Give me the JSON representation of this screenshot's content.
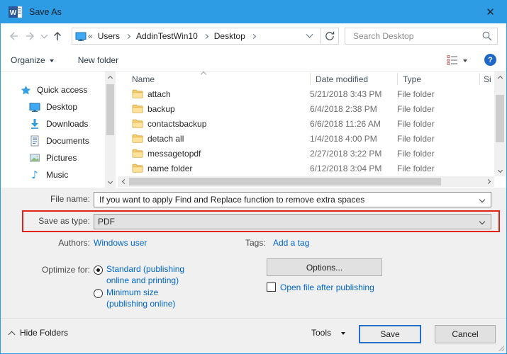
{
  "window": {
    "title": "Save As"
  },
  "icons": {
    "help_glyph": "?",
    "music_glyph": "♪",
    "word_glyph": "W"
  },
  "navbar": {
    "breadcrumb": {
      "collapsed_indicator": "«",
      "items": [
        "Users",
        "AddinTestWin10",
        "Desktop"
      ]
    },
    "search": {
      "placeholder": "Search Desktop"
    }
  },
  "toolbar": {
    "organize_label": "Organize",
    "new_folder_label": "New folder"
  },
  "sidebar": {
    "items": [
      {
        "label": "Quick access",
        "pinned": false
      },
      {
        "label": "Desktop",
        "pinned": true
      },
      {
        "label": "Downloads",
        "pinned": true
      },
      {
        "label": "Documents",
        "pinned": true
      },
      {
        "label": "Pictures",
        "pinned": true
      },
      {
        "label": "Music",
        "pinned": false
      }
    ]
  },
  "filelist": {
    "columns": [
      "Name",
      "Date modified",
      "Type",
      "Si"
    ],
    "rows": [
      {
        "name": "attach",
        "date": "5/21/2018 3:43 PM",
        "type": "File folder"
      },
      {
        "name": "backup",
        "date": "6/4/2018 2:38 PM",
        "type": "File folder"
      },
      {
        "name": "contactsbackup",
        "date": "6/6/2018 11:26 AM",
        "type": "File folder"
      },
      {
        "name": "detach all",
        "date": "1/4/2018 4:00 PM",
        "type": "File folder"
      },
      {
        "name": "messagetopdf",
        "date": "2/27/2018 3:22 PM",
        "type": "File folder"
      },
      {
        "name": "name folder",
        "date": "6/12/2018 3:04 PM",
        "type": "File folder"
      }
    ]
  },
  "fields": {
    "file_name": {
      "label": "File name:",
      "value": "If you want to apply Find and Replace function to remove extra spaces"
    },
    "save_as_type": {
      "label": "Save as type:",
      "value": "PDF"
    },
    "authors": {
      "label": "Authors:",
      "value": "Windows user"
    },
    "tags": {
      "label": "Tags:",
      "link": "Add a tag"
    },
    "optimize": {
      "label": "Optimize for:",
      "standard_label": "Standard (publishing online and printing)",
      "minimum_label": "Minimum size (publishing online)"
    },
    "options_button": "Options...",
    "open_after_label": "Open file after publishing"
  },
  "footer": {
    "hide_folders": "Hide Folders",
    "tools": "Tools",
    "save": "Save",
    "cancel": "Cancel"
  },
  "colors": {
    "accent_blue": "#2e9ce4",
    "annotation_red": "#e2231a",
    "link_blue": "#0066cc"
  }
}
